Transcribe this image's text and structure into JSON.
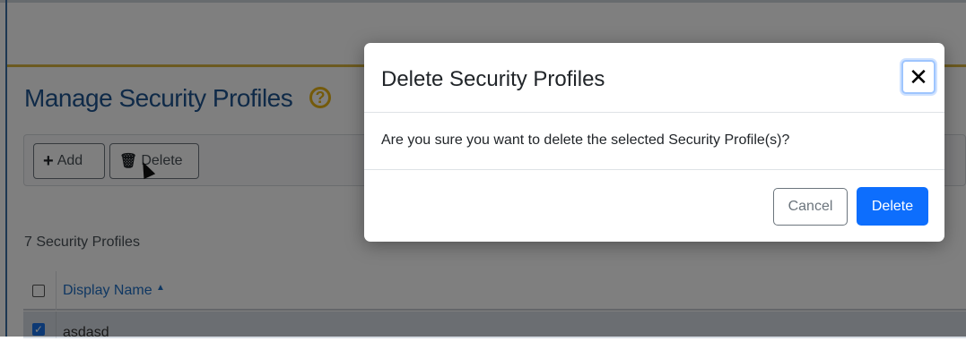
{
  "page": {
    "title": "Manage Security Profiles",
    "help_icon": "?",
    "toolbar": {
      "add_icon": "+",
      "add_label": "Add",
      "delete_icon": "🗑",
      "delete_label": "Delete"
    },
    "count_text": "7 Security Profiles",
    "table": {
      "header": {
        "name": "Display Name",
        "sort_indicator": "▲"
      },
      "rows": [
        {
          "name": "asdasd",
          "checked": true
        }
      ]
    }
  },
  "modal": {
    "title": "Delete Security Profiles",
    "close_icon": "✕",
    "message": "Are you sure you want to delete the selected Security Profile(s)?",
    "cancel_label": "Cancel",
    "confirm_label": "Delete"
  },
  "colors": {
    "accent": "#0d6efd",
    "title_blue": "#1f5590",
    "gold": "#d9b441",
    "help_yellow": "#e8b516"
  }
}
